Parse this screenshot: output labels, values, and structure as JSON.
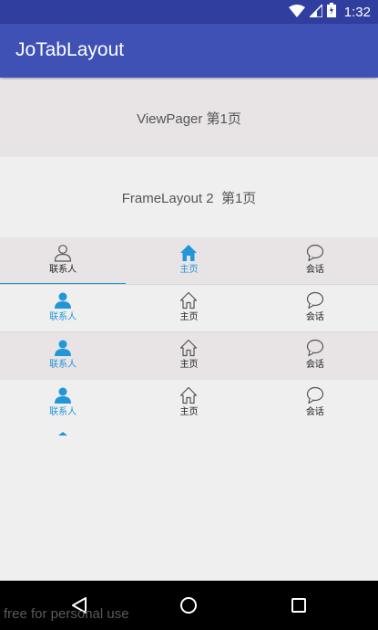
{
  "status_bar": {
    "time": "1:32",
    "icons": [
      "wifi-icon",
      "signal-icon",
      "battery-icon"
    ]
  },
  "app_bar": {
    "title": "JoTabLayout"
  },
  "viewpager": {
    "text": "ViewPager 第1页"
  },
  "framelayout": {
    "text": "FrameLayout 2  第1页"
  },
  "tab_bars": [
    {
      "style": "underline",
      "selected": 1,
      "tabs": [
        {
          "label": "联系人",
          "icon": "person-icon"
        },
        {
          "label": "主页",
          "icon": "home-icon"
        },
        {
          "label": "会话",
          "icon": "chat-icon"
        }
      ]
    },
    {
      "style": "plain",
      "selected": 0,
      "tabs": [
        {
          "label": "联系人",
          "icon": "person-icon"
        },
        {
          "label": "主页",
          "icon": "home-icon"
        },
        {
          "label": "会话",
          "icon": "chat-icon"
        }
      ]
    },
    {
      "style": "plain",
      "selected": 0,
      "tabs": [
        {
          "label": "联系人",
          "icon": "person-icon"
        },
        {
          "label": "主页",
          "icon": "home-icon"
        },
        {
          "label": "会话",
          "icon": "chat-icon"
        }
      ]
    },
    {
      "style": "triangle",
      "selected": 0,
      "tabs": [
        {
          "label": "联系人",
          "icon": "person-icon"
        },
        {
          "label": "主页",
          "icon": "home-icon"
        },
        {
          "label": "会话",
          "icon": "chat-icon"
        }
      ]
    }
  ],
  "nav_bar": {
    "buttons": [
      "back-icon",
      "home-circle-icon",
      "recents-icon"
    ]
  },
  "watermark": "free for personal use",
  "colors": {
    "primary": "#3f51b5",
    "primary_dark": "#303f9f",
    "accent": "#2196d8"
  }
}
